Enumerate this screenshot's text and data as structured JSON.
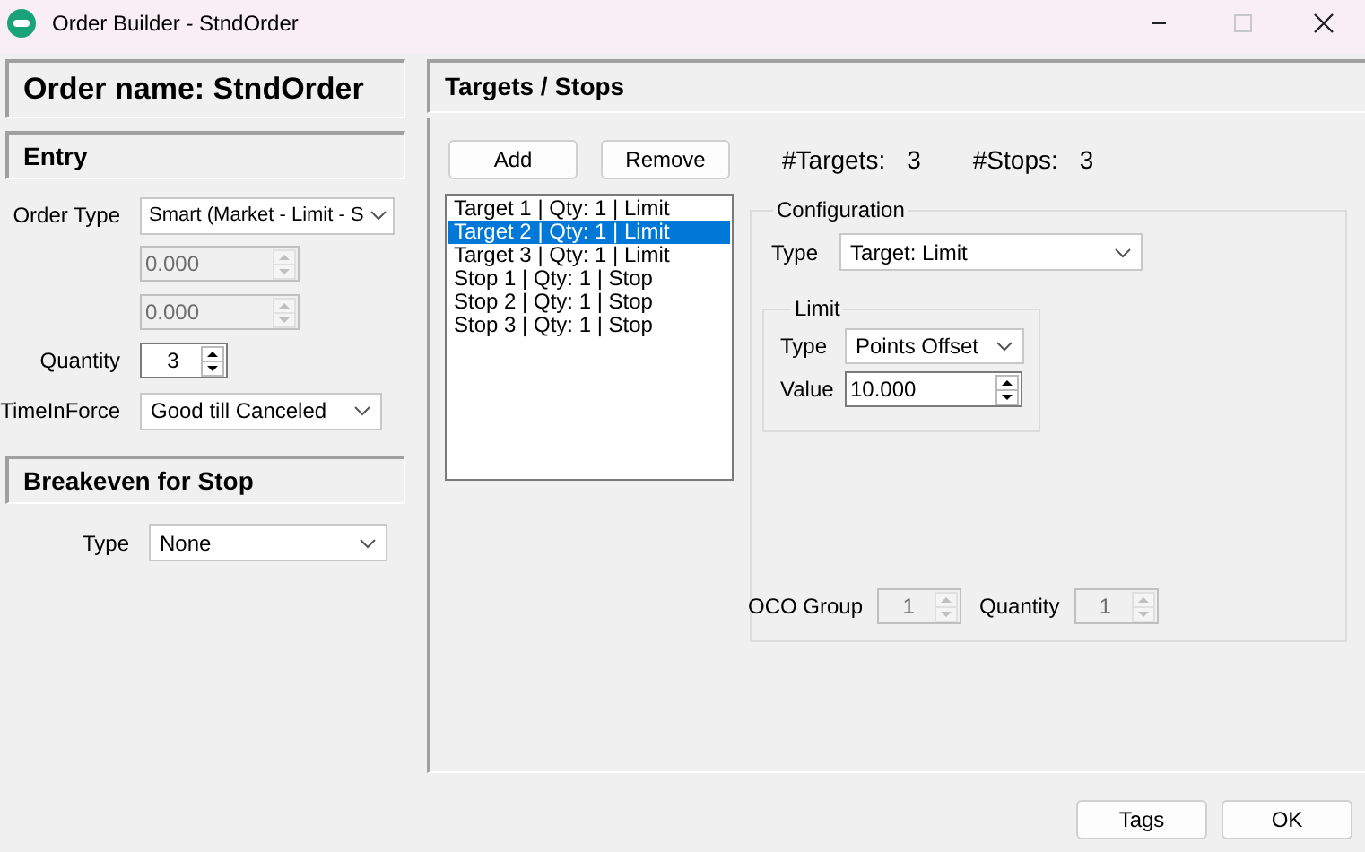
{
  "window": {
    "title": "Order Builder - StndOrder",
    "controls": [
      {
        "kind": "minimize",
        "disabled": false
      },
      {
        "kind": "maximize",
        "disabled": true
      },
      {
        "kind": "close",
        "disabled": false
      }
    ]
  },
  "order_name": "Order name: StndOrder",
  "entry": {
    "title": "Entry",
    "fields": [
      {
        "kind": "dropdown",
        "label": "Order Type",
        "value": "Smart (Market - Limit - S",
        "disabled": false
      },
      {
        "kind": "spinner",
        "value": "0.000",
        "disabled": true
      },
      {
        "kind": "spinner",
        "value": "0.000",
        "disabled": true
      },
      {
        "kind": "spinner",
        "label": "Quantity",
        "value": "3",
        "disabled": false
      },
      {
        "kind": "dropdown",
        "label": "TimeInForce",
        "value": "Good till Canceled",
        "disabled": false
      }
    ]
  },
  "breakeven": {
    "title": "Breakeven for Stop",
    "fields": [
      {
        "kind": "dropdown",
        "label": "Type",
        "value": "None",
        "disabled": false
      }
    ]
  },
  "targets_stops": {
    "title": "Targets / Stops",
    "buttons": [
      "Add",
      "Remove"
    ],
    "counts": [
      {
        "label": "#Targets:",
        "value": "3"
      },
      {
        "label": "#Stops:",
        "value": "3"
      }
    ],
    "list": [
      {
        "text": "Target 1 | Qty: 1 | Limit",
        "selected": false
      },
      {
        "text": "Target 2 | Qty: 1 | Limit",
        "selected": true
      },
      {
        "text": "Target 3 | Qty: 1 | Limit",
        "selected": false
      },
      {
        "text": "Stop 1 | Qty: 1 | Stop",
        "selected": false
      },
      {
        "text": "Stop 2 | Qty: 1 | Stop",
        "selected": false
      },
      {
        "text": "Stop 3 | Qty: 1 | Stop",
        "selected": false
      }
    ],
    "configuration": {
      "title": "Configuration",
      "fields": [
        {
          "kind": "dropdown",
          "label": "Type",
          "value": "Target: Limit",
          "disabled": false
        }
      ],
      "limit": {
        "title": "Limit",
        "fields": [
          {
            "kind": "dropdown",
            "label": "Type",
            "value": "Points Offset",
            "disabled": false
          },
          {
            "kind": "spinner",
            "label": "Value",
            "value": "10.000",
            "disabled": false
          }
        ]
      },
      "bottom_fields": [
        {
          "kind": "spinner",
          "label": "OCO Group",
          "value": "1",
          "disabled": true
        },
        {
          "kind": "spinner",
          "label": "Quantity",
          "value": "1",
          "disabled": true
        }
      ]
    }
  },
  "footer_buttons": [
    "Tags",
    "OK"
  ]
}
